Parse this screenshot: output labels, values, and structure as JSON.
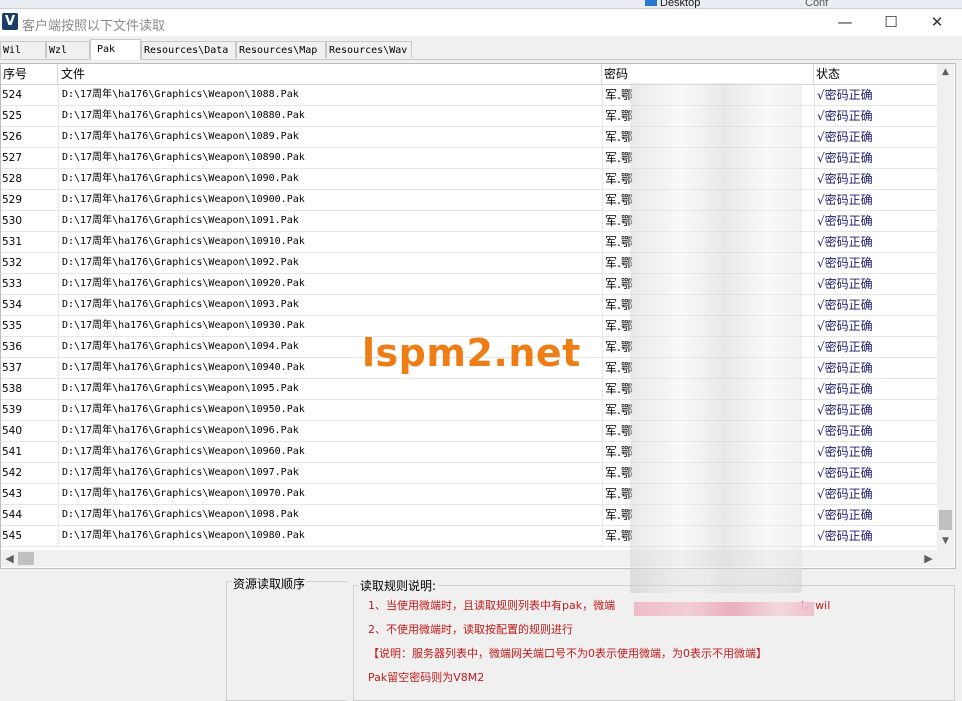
{
  "background": {
    "desktop_label": "Desktop",
    "desktop_fragment": "Conf"
  },
  "window": {
    "title": "客户端按照以下文件读取",
    "app_icon_letter": "V",
    "controls": {
      "minimize": "—",
      "maximize": "☐",
      "close": "✕"
    }
  },
  "tabs": [
    "Wil",
    "Wzl",
    "Pak",
    "Resources\\Data",
    "Resources\\Map",
    "Resources\\Wav"
  ],
  "active_tab": "Pak",
  "table": {
    "columns": [
      "序号",
      "文件",
      "密码",
      "状态"
    ],
    "rows": [
      {
        "idx": "524",
        "file": "D:\\17周年\\ha176\\Graphics\\Weapon\\1088.Pak",
        "pw": "军.鄂",
        "status": "√密码正确"
      },
      {
        "idx": "525",
        "file": "D:\\17周年\\ha176\\Graphics\\Weapon\\10880.Pak",
        "pw": "军.鄂",
        "status": "√密码正确"
      },
      {
        "idx": "526",
        "file": "D:\\17周年\\ha176\\Graphics\\Weapon\\1089.Pak",
        "pw": "军.鄂",
        "status": "√密码正确"
      },
      {
        "idx": "527",
        "file": "D:\\17周年\\ha176\\Graphics\\Weapon\\10890.Pak",
        "pw": "军.鄂",
        "status": "√密码正确"
      },
      {
        "idx": "528",
        "file": "D:\\17周年\\ha176\\Graphics\\Weapon\\1090.Pak",
        "pw": "军.鄂",
        "status": "√密码正确"
      },
      {
        "idx": "529",
        "file": "D:\\17周年\\ha176\\Graphics\\Weapon\\10900.Pak",
        "pw": "军.鄂",
        "status": "√密码正确"
      },
      {
        "idx": "530",
        "file": "D:\\17周年\\ha176\\Graphics\\Weapon\\1091.Pak",
        "pw": "军.鄂",
        "status": "√密码正确"
      },
      {
        "idx": "531",
        "file": "D:\\17周年\\ha176\\Graphics\\Weapon\\10910.Pak",
        "pw": "军.鄂",
        "status": "√密码正确"
      },
      {
        "idx": "532",
        "file": "D:\\17周年\\ha176\\Graphics\\Weapon\\1092.Pak",
        "pw": "军.鄂",
        "status": "√密码正确"
      },
      {
        "idx": "533",
        "file": "D:\\17周年\\ha176\\Graphics\\Weapon\\10920.Pak",
        "pw": "军.鄂",
        "status": "√密码正确"
      },
      {
        "idx": "534",
        "file": "D:\\17周年\\ha176\\Graphics\\Weapon\\1093.Pak",
        "pw": "军.鄂",
        "status": "√密码正确"
      },
      {
        "idx": "535",
        "file": "D:\\17周年\\ha176\\Graphics\\Weapon\\10930.Pak",
        "pw": "军.鄂",
        "status": "√密码正确"
      },
      {
        "idx": "536",
        "file": "D:\\17周年\\ha176\\Graphics\\Weapon\\1094.Pak",
        "pw": "军.鄂",
        "status": "√密码正确"
      },
      {
        "idx": "537",
        "file": "D:\\17周年\\ha176\\Graphics\\Weapon\\10940.Pak",
        "pw": "军.鄂",
        "status": "√密码正确"
      },
      {
        "idx": "538",
        "file": "D:\\17周年\\ha176\\Graphics\\Weapon\\1095.Pak",
        "pw": "军.鄂",
        "status": "√密码正确"
      },
      {
        "idx": "539",
        "file": "D:\\17周年\\ha176\\Graphics\\Weapon\\10950.Pak",
        "pw": "军.鄂",
        "status": "√密码正确"
      },
      {
        "idx": "540",
        "file": "D:\\17周年\\ha176\\Graphics\\Weapon\\1096.Pak",
        "pw": "军.鄂",
        "status": "√密码正确"
      },
      {
        "idx": "541",
        "file": "D:\\17周年\\ha176\\Graphics\\Weapon\\10960.Pak",
        "pw": "军.鄂",
        "status": "√密码正确"
      },
      {
        "idx": "542",
        "file": "D:\\17周年\\ha176\\Graphics\\Weapon\\1097.Pak",
        "pw": "军.鄂",
        "status": "√密码正确"
      },
      {
        "idx": "543",
        "file": "D:\\17周年\\ha176\\Graphics\\Weapon\\10970.Pak",
        "pw": "军.鄂",
        "status": "√密码正确"
      },
      {
        "idx": "544",
        "file": "D:\\17周年\\ha176\\Graphics\\Weapon\\1098.Pak",
        "pw": "军.鄂",
        "status": "√密码正确"
      },
      {
        "idx": "545",
        "file": "D:\\17周年\\ha176\\Graphics\\Weapon\\10980.Pak",
        "pw": "军.鄂",
        "status": "√密码正确"
      }
    ]
  },
  "scrollbar": {
    "up": "▲",
    "down": "▼",
    "left": "◀",
    "right": "▶"
  },
  "resource_order": {
    "label": "资源读取顺序"
  },
  "rules": {
    "label": "读取规则说明:",
    "line1_a": "1、当使用微端时，且读取规则列表中有pak，微端",
    "line1_b": "l，wil",
    "line2": "2、不使用微端时，读取按配置的规则进行",
    "line3": "【说明：服务器列表中，微端网关端口号不为0表示使用微端，为0表示不用微端】",
    "line4": "Pak留空密码则为V8M2"
  },
  "watermark": "lspm2.net"
}
